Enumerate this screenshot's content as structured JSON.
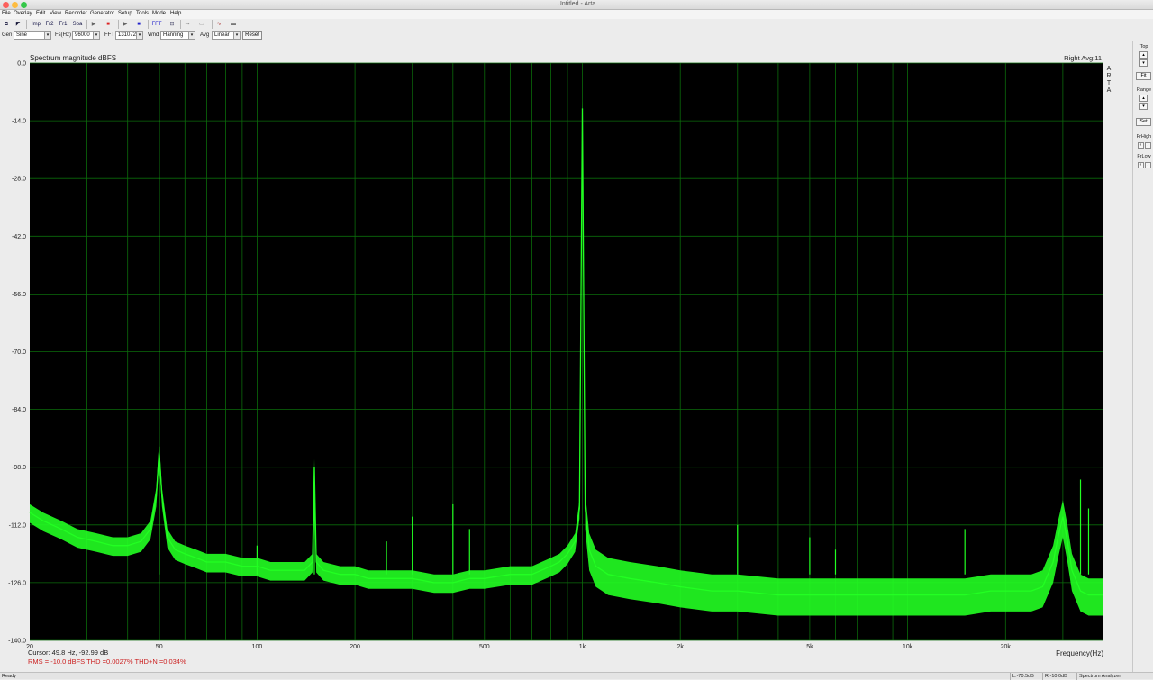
{
  "window": {
    "title": "Untitled - Arta"
  },
  "menu": [
    "File",
    "Overlay",
    "Edit",
    "View",
    "Recorder",
    "Generator",
    "Setup",
    "Tools",
    "Mode",
    "Help"
  ],
  "toolbar": {
    "buttons": [
      {
        "name": "open-icon",
        "glyph": "⧉"
      },
      {
        "name": "pointer-icon",
        "glyph": "◤"
      },
      {
        "name": "imp-button",
        "glyph": "Imp"
      },
      {
        "name": "fr2-button",
        "glyph": "Fr2"
      },
      {
        "name": "fr1-button",
        "glyph": "Fr1"
      },
      {
        "name": "spa-button",
        "glyph": "Spa"
      },
      {
        "name": "play-icon",
        "glyph": "▶"
      },
      {
        "name": "stop-icon",
        "glyph": "■"
      },
      {
        "name": "play2-icon",
        "glyph": "▶"
      },
      {
        "name": "stop2-icon",
        "glyph": "■"
      },
      {
        "name": "fft-icon",
        "glyph": "FFT"
      },
      {
        "name": "zoom-icon",
        "glyph": "⊡"
      },
      {
        "name": "signal-icon",
        "glyph": "⇝"
      },
      {
        "name": "meter-icon",
        "glyph": "▭"
      },
      {
        "name": "scope-icon",
        "glyph": "∿"
      },
      {
        "name": "record-icon",
        "glyph": "▬"
      }
    ]
  },
  "controls": {
    "gen_label": "Gen",
    "gen_value": "Sine",
    "fs_label": "Fs(Hz)",
    "fs_value": "96000",
    "fft_label": "FFT",
    "fft_value": "131072",
    "wnd_label": "Wnd",
    "wnd_value": "Hanning",
    "avg_label": "Avg",
    "avg_value": "Linear",
    "reset_label": "Reset"
  },
  "right_panel": {
    "top_label": "Top",
    "fit_label": "Fit",
    "range_label": "Range",
    "set_label": "Set",
    "frhigh_label": "FrHigh",
    "frlow_label": "FrLow"
  },
  "plot": {
    "readout_title": "Spectrum magnitude dBFS",
    "channel_avg": "Right  Avg:11",
    "watermark": "ARTA",
    "cursor_text": "Cursor:   49.8 Hz, -92.99 dB",
    "stats_text": "RMS =  -10.0 dBFS   THD =0.0027%   THD+N =0.034%"
  },
  "status": {
    "ready": "Ready",
    "left_level": "L:-70.5dB",
    "right_level": "R:-10.0dB",
    "mode": "Spectrum Analyzer"
  },
  "colors": {
    "plot_bg": "#000000",
    "grid": "#0b6b0b",
    "trace": "#22ff22",
    "stats": "#cc2222"
  },
  "chart_data": {
    "type": "line",
    "title": "Spectrum magnitude dBFS",
    "xlabel": "Frequency(Hz)",
    "ylabel": "",
    "x_scale": "log",
    "xlim": [
      20,
      40000
    ],
    "ylim": [
      -140,
      0
    ],
    "x_ticks": [
      {
        "value": 20,
        "label": "20"
      },
      {
        "value": 50,
        "label": "50"
      },
      {
        "value": 100,
        "label": "100"
      },
      {
        "value": 200,
        "label": "200"
      },
      {
        "value": 500,
        "label": "500"
      },
      {
        "value": 1000,
        "label": "1k"
      },
      {
        "value": 2000,
        "label": "2k"
      },
      {
        "value": 5000,
        "label": "5k"
      },
      {
        "value": 10000,
        "label": "10k"
      },
      {
        "value": 20000,
        "label": "20k"
      }
    ],
    "y_ticks": [
      0.0,
      -14.0,
      -28.0,
      -42.0,
      -56.0,
      -70.0,
      -84.0,
      -98.0,
      -112.0,
      -126.0,
      -140.0
    ],
    "grid": true,
    "series": [
      {
        "x": [
          20,
          22,
          25,
          28,
          32,
          36,
          40,
          44,
          47,
          49,
          50,
          51,
          53,
          56,
          60,
          65,
          70,
          80,
          90,
          100,
          110,
          125,
          140,
          148,
          150,
          152,
          160,
          180,
          200,
          220,
          250,
          300,
          350,
          400,
          450,
          500,
          600,
          700,
          800,
          850,
          900,
          950,
          980,
          1000,
          1020,
          1050,
          1100,
          1200,
          1400,
          1700,
          2000,
          2500,
          3000,
          4000,
          5000,
          6000,
          7000,
          8000,
          10000,
          12000,
          15000,
          18000,
          20000,
          22000,
          24000,
          26000,
          28000,
          29000,
          30000,
          31000,
          32000,
          34000,
          36000,
          38000,
          40000
        ],
        "y": [
          -109,
          -111,
          -113,
          -115,
          -116,
          -117,
          -117,
          -116,
          -113,
          -105,
          -94,
          -105,
          -115,
          -118,
          -119,
          -120,
          -121,
          -121,
          -122,
          -122,
          -123,
          -123,
          -123,
          -121,
          -98,
          -121,
          -123,
          -124,
          -124,
          -125,
          -125,
          -125,
          -126,
          -126,
          -125,
          -125,
          -124,
          -124,
          -122,
          -121,
          -119,
          -116,
          -108,
          -11,
          -108,
          -118,
          -122,
          -124,
          -125,
          -126,
          -127,
          -128,
          -128,
          -129,
          -129,
          -129,
          -129,
          -129,
          -129,
          -129,
          -129,
          -128,
          -128,
          -128,
          -128,
          -127,
          -121,
          -115,
          -110,
          -116,
          -123,
          -128,
          -129,
          -129,
          -129
        ]
      }
    ],
    "spurs": [
      {
        "x": 50,
        "y": -93
      },
      {
        "x": 100,
        "y": -117
      },
      {
        "x": 150,
        "y": -98
      },
      {
        "x": 250,
        "y": -116
      },
      {
        "x": 300,
        "y": -110
      },
      {
        "x": 400,
        "y": -107
      },
      {
        "x": 450,
        "y": -113
      },
      {
        "x": 3000,
        "y": -112
      },
      {
        "x": 5000,
        "y": -115
      },
      {
        "x": 6000,
        "y": -118
      },
      {
        "x": 15000,
        "y": -113
      },
      {
        "x": 34000,
        "y": -101
      },
      {
        "x": 36000,
        "y": -108
      }
    ]
  }
}
